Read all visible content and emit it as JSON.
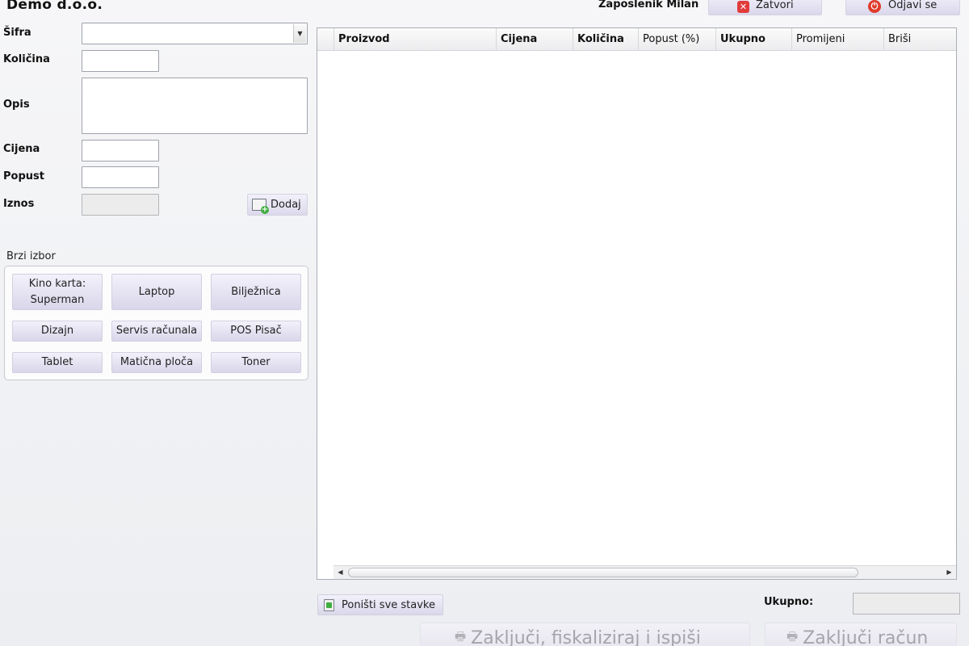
{
  "header": {
    "company": "Demo d.o.o.",
    "employee": "Zaposlenik Milan",
    "close_label": "Zatvori",
    "logout_label": "Odjavi se"
  },
  "form": {
    "code_label": "Šifra",
    "code_value": "",
    "quantity_label": "Količina",
    "quantity_value": "",
    "description_label": "Opis",
    "description_value": "",
    "price_label": "Cijena",
    "price_value": "",
    "discount_label": "Popust",
    "discount_value": "",
    "amount_label": "Iznos",
    "amount_value": "",
    "add_label": "Dodaj"
  },
  "quick_select": {
    "title": "Brzi izbor",
    "items": [
      {
        "label": "Kino karta: Superman"
      },
      {
        "label": "Laptop"
      },
      {
        "label": "Bilježnica"
      },
      {
        "label": "Dizajn"
      },
      {
        "label": "Servis računala"
      },
      {
        "label": "POS Pisač"
      },
      {
        "label": "Tablet"
      },
      {
        "label": "Matična ploča"
      },
      {
        "label": "Toner"
      }
    ]
  },
  "grid": {
    "columns": [
      {
        "label": "Proizvod"
      },
      {
        "label": "Cijena"
      },
      {
        "label": "Količina"
      },
      {
        "label": "Popust (%)"
      },
      {
        "label": "Ukupno"
      },
      {
        "label": "Promijeni"
      },
      {
        "label": "Briši"
      }
    ],
    "rows": []
  },
  "footer": {
    "cancel_all_label": "Poništi sve stavke",
    "total_label": "Ukupno:",
    "total_value": "",
    "finalize_fiscal_label": "Zaključi, fiskaliziraj i ispiši",
    "finalize_label": "Zaključi račun"
  },
  "icons": {
    "close": "close-icon",
    "logout": "power-icon",
    "add": "add-item-icon",
    "cancel_all": "undo-icon",
    "print": "printer-icon",
    "dropdown": "chevron-down-icon"
  }
}
